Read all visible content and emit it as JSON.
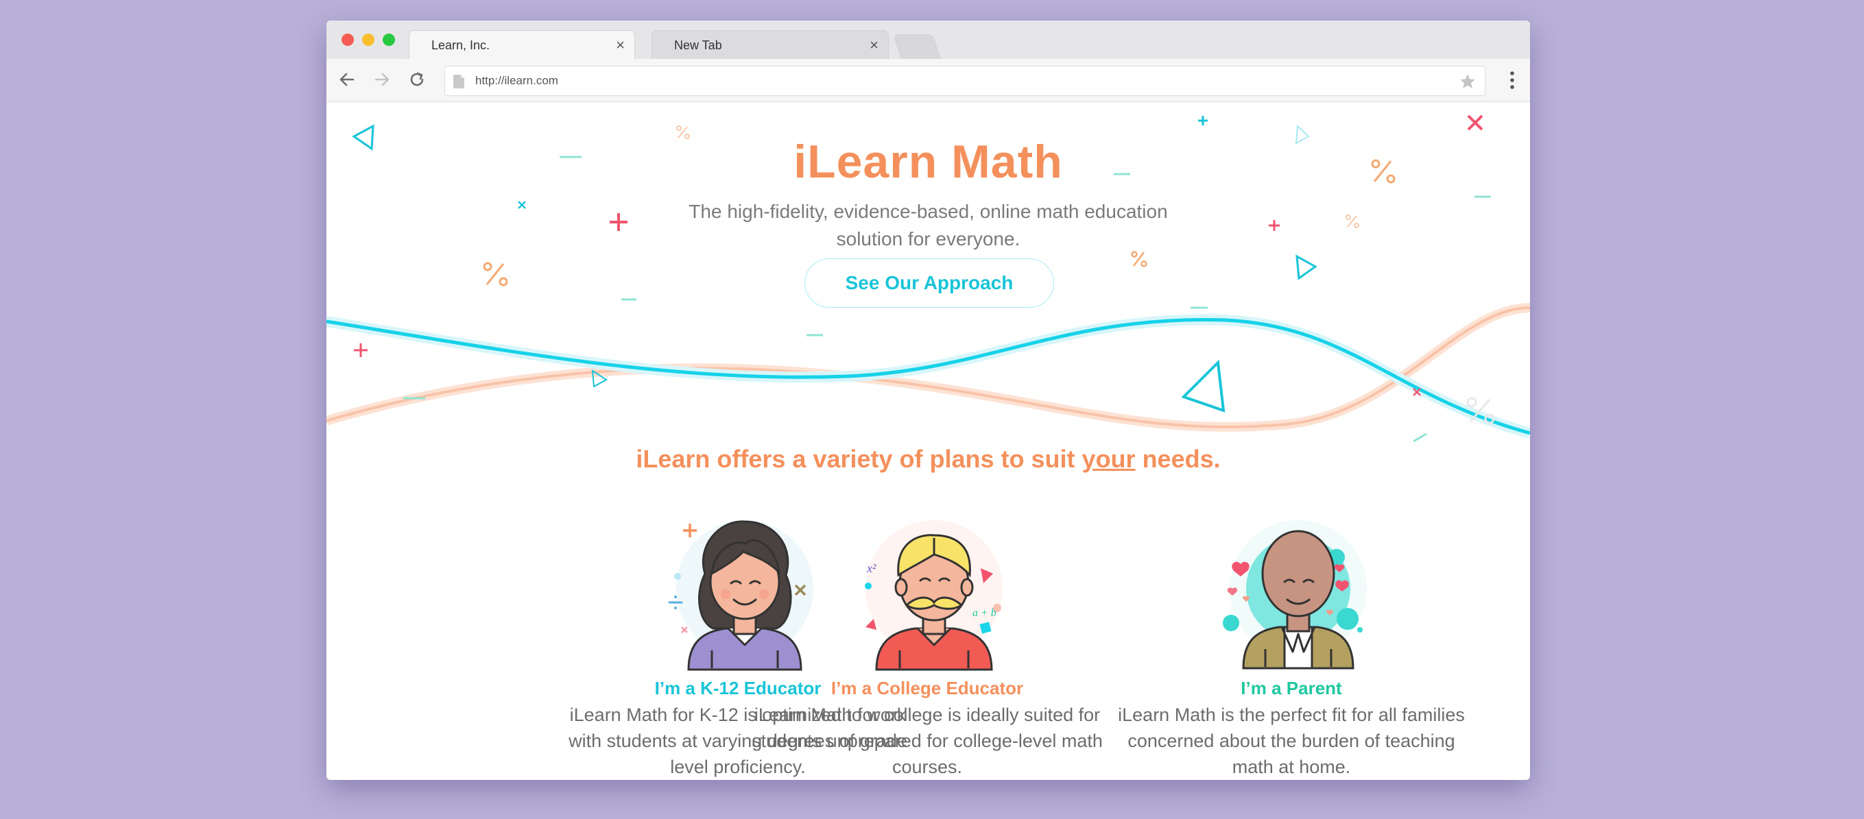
{
  "browser": {
    "tabs": [
      {
        "label": "Learn, Inc.",
        "close": "×"
      },
      {
        "label": "New Tab",
        "close": "×"
      }
    ],
    "url": "http://ilearn.com"
  },
  "hero": {
    "title": "iLearn Math",
    "subtitle": "The high-fidelity, evidence-based, online math education solution for everyone.",
    "cta_label": "See Our Approach"
  },
  "plans": {
    "heading_pre": "iLearn offers a variety of plans to suit ",
    "heading_emph": "your",
    "heading_post": " needs.",
    "items": [
      {
        "title": "I’m a K-12 Educator",
        "description": "iLearn Math for K-12 is optimized to work with students at varying degrees of grade level proficiency.",
        "color": "#19c4d8"
      },
      {
        "title": "I’m a College Educator",
        "description": "iLearn Math for college is ideally suited for students unprepared for college-level math courses.",
        "color": "#f4905c"
      },
      {
        "title": "I’m a Parent",
        "description": "iLearn Math is the perfect fit for all families concerned about the burden of teaching math at home.",
        "color": "#1ec8a0"
      }
    ]
  },
  "colors": {
    "accent_orange": "#f4905c",
    "accent_cyan": "#19c4d8",
    "accent_green": "#1ec8a0",
    "accent_pink": "#f2546e",
    "background": "#b8b0d8"
  }
}
